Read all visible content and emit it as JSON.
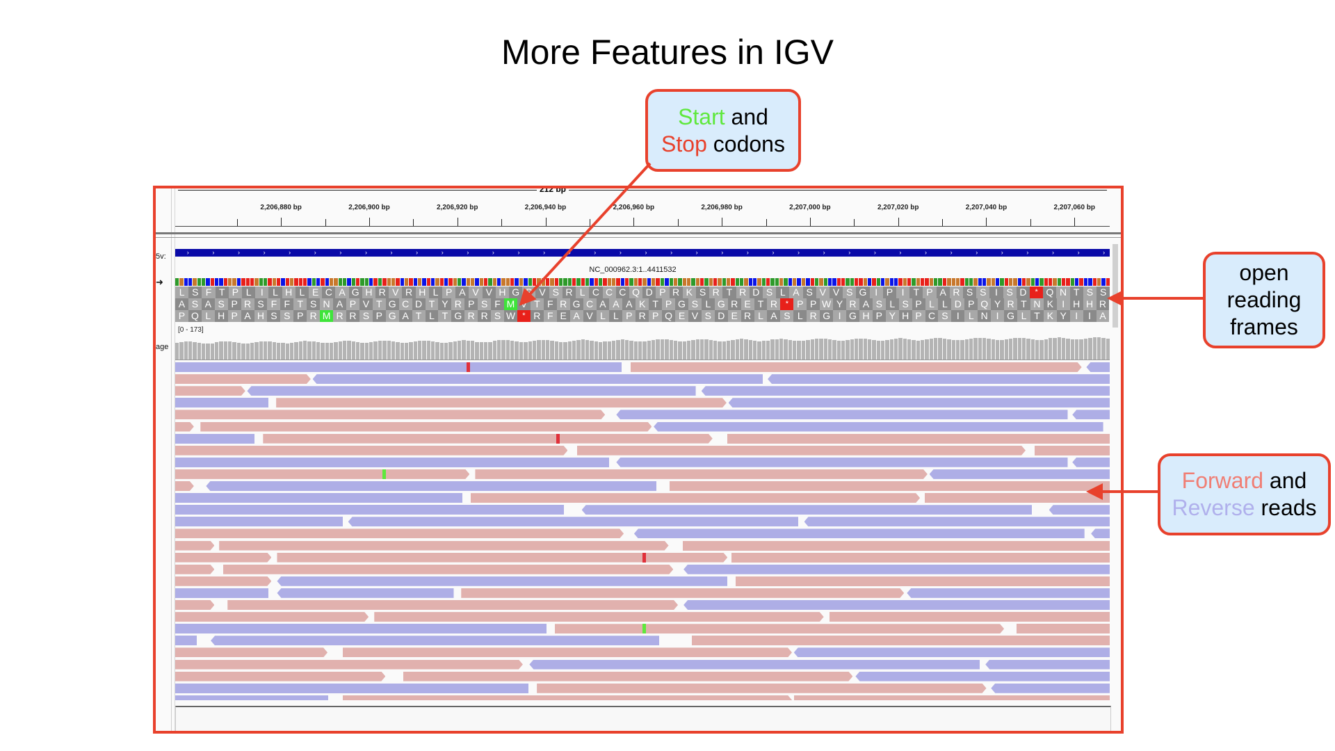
{
  "title": "More Features in IGV",
  "igv": {
    "ruler": {
      "span_label": "212 bp",
      "ticks": [
        "2,206,880 bp",
        "2,206,900 bp",
        "2,206,920 bp",
        "2,206,940 bp",
        "2,206,960 bp",
        "2,206,980 bp",
        "2,207,000 bp",
        "2,207,020 bp",
        "2,207,040 bp",
        "2,207,060 bp"
      ]
    },
    "track_labels": {
      "gene": "5v:",
      "sequence_arrow": "➜",
      "coverage": "age"
    },
    "sequence_label": "NC_000962.3:1..4411532",
    "coverage_range": "[0 - 173]",
    "colors": {
      "A": "#2e9a2a",
      "C": "#0a14e8",
      "G": "#c8782c",
      "T": "#e8201a",
      "forward_read": "#e1b1ae",
      "reverse_read": "#aeaee6",
      "start_codon": "#3fe43a",
      "stop_codon": "#e8201a",
      "gene": "#0a0aa8"
    },
    "frames": [
      "LSFTPLILHLECAGHRVRHLPAVVHGPVSRLCCCQDPRKSRTRDSLASVVSGIPITPARSSISD*QNTSS",
      "ASASPRSFFTSNAPVTGCDTYRPSFMVTFRGCAAAKTPGSLGRETR*PPWYRASLSPLLDPQYRTNKIHHR",
      "PQLHPAHSSPRMRRSPGATLTGRRSW*RFEAVLLPRPQEVSDERLASLRGIGHPYHPCSILNIGLTKYIIA"
    ]
  },
  "callouts": {
    "start_stop": {
      "start": "Start",
      "and": " and",
      "stop": "Stop",
      "codons": " codons"
    },
    "orf": {
      "line1": "open",
      "line2": "reading",
      "line3": "frames"
    },
    "reads": {
      "forward": "Forward",
      "and": " and",
      "reverse": "Reverse",
      "reads": " reads"
    }
  }
}
